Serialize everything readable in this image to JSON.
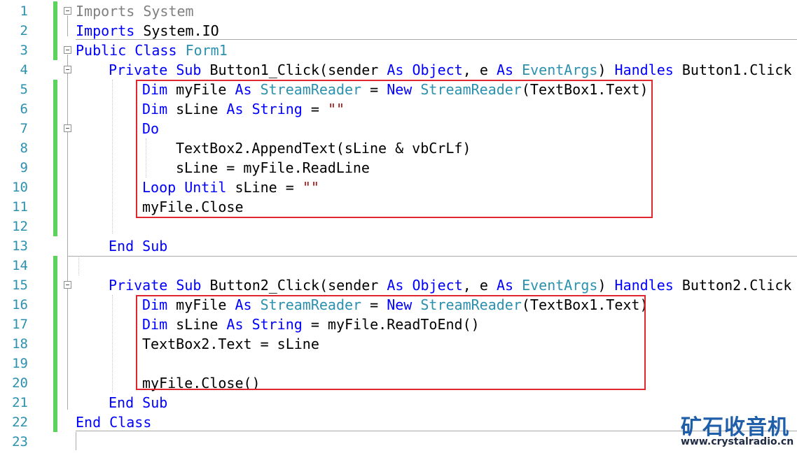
{
  "editor": {
    "line_numbers": [
      "1",
      "2",
      "3",
      "4",
      "5",
      "6",
      "7",
      "8",
      "9",
      "10",
      "11",
      "12",
      "13",
      "14",
      "15",
      "16",
      "17",
      "18",
      "19",
      "20",
      "21",
      "22",
      "23"
    ],
    "lines": [
      {
        "n": 1,
        "indent": 0,
        "tokens": [
          [
            "gr",
            "Imports"
          ],
          [
            "gr",
            " System"
          ]
        ]
      },
      {
        "n": 2,
        "indent": 0,
        "tokens": [
          [
            "kw",
            "Imports"
          ],
          [
            "pl",
            " System.IO"
          ]
        ]
      },
      {
        "n": 3,
        "indent": 0,
        "tokens": [
          [
            "kw",
            "Public"
          ],
          [
            "pl",
            " "
          ],
          [
            "kw",
            "Class"
          ],
          [
            "pl",
            " "
          ],
          [
            "ty",
            "Form1"
          ]
        ]
      },
      {
        "n": 4,
        "indent": 1,
        "tokens": [
          [
            "kw",
            "Private"
          ],
          [
            "pl",
            " "
          ],
          [
            "kw",
            "Sub"
          ],
          [
            "pl",
            " Button1_Click(sender "
          ],
          [
            "kw",
            "As"
          ],
          [
            "pl",
            " "
          ],
          [
            "kw",
            "Object"
          ],
          [
            "pl",
            ", e "
          ],
          [
            "kw",
            "As"
          ],
          [
            "pl",
            " "
          ],
          [
            "ty",
            "EventArgs"
          ],
          [
            "pl",
            ") "
          ],
          [
            "kw",
            "Handles"
          ],
          [
            "pl",
            " Button1.Click"
          ]
        ]
      },
      {
        "n": 5,
        "indent": 2,
        "tokens": [
          [
            "kw",
            "Dim"
          ],
          [
            "pl",
            " myFile "
          ],
          [
            "kw",
            "As"
          ],
          [
            "pl",
            " "
          ],
          [
            "ty",
            "StreamReader"
          ],
          [
            "pl",
            " = "
          ],
          [
            "kw",
            "New"
          ],
          [
            "pl",
            " "
          ],
          [
            "ty",
            "StreamReader"
          ],
          [
            "pl",
            "(TextBox1.Text)"
          ]
        ]
      },
      {
        "n": 6,
        "indent": 2,
        "tokens": [
          [
            "kw",
            "Dim"
          ],
          [
            "pl",
            " sLine "
          ],
          [
            "kw",
            "As"
          ],
          [
            "pl",
            " "
          ],
          [
            "kw",
            "String"
          ],
          [
            "pl",
            " = "
          ],
          [
            "st",
            "\"\""
          ]
        ]
      },
      {
        "n": 7,
        "indent": 2,
        "tokens": [
          [
            "kw",
            "Do"
          ]
        ]
      },
      {
        "n": 8,
        "indent": 3,
        "tokens": [
          [
            "pl",
            "TextBox2.AppendText(sLine & vbCrLf)"
          ]
        ]
      },
      {
        "n": 9,
        "indent": 3,
        "tokens": [
          [
            "pl",
            "sLine = myFile.ReadLine"
          ]
        ]
      },
      {
        "n": 10,
        "indent": 2,
        "tokens": [
          [
            "kw",
            "Loop"
          ],
          [
            "pl",
            " "
          ],
          [
            "kw",
            "Until"
          ],
          [
            "pl",
            " sLine = "
          ],
          [
            "st",
            "\"\""
          ]
        ]
      },
      {
        "n": 11,
        "indent": 2,
        "tokens": [
          [
            "pl",
            "myFile.Close"
          ]
        ]
      },
      {
        "n": 12,
        "indent": 2,
        "tokens": []
      },
      {
        "n": 13,
        "indent": 1,
        "tokens": [
          [
            "kw",
            "End"
          ],
          [
            "pl",
            " "
          ],
          [
            "kw",
            "Sub"
          ]
        ]
      },
      {
        "n": 14,
        "indent": 1,
        "tokens": []
      },
      {
        "n": 15,
        "indent": 1,
        "tokens": [
          [
            "kw",
            "Private"
          ],
          [
            "pl",
            " "
          ],
          [
            "kw",
            "Sub"
          ],
          [
            "pl",
            " Button2_Click(sender "
          ],
          [
            "kw",
            "As"
          ],
          [
            "pl",
            " "
          ],
          [
            "kw",
            "Object"
          ],
          [
            "pl",
            ", e "
          ],
          [
            "kw",
            "As"
          ],
          [
            "pl",
            " "
          ],
          [
            "ty",
            "EventArgs"
          ],
          [
            "pl",
            ") "
          ],
          [
            "kw",
            "Handles"
          ],
          [
            "pl",
            " Button2.Click"
          ]
        ]
      },
      {
        "n": 16,
        "indent": 2,
        "tokens": [
          [
            "kw",
            "Dim"
          ],
          [
            "pl",
            " myFile "
          ],
          [
            "kw",
            "As"
          ],
          [
            "pl",
            " "
          ],
          [
            "ty",
            "StreamReader"
          ],
          [
            "pl",
            " = "
          ],
          [
            "kw",
            "New"
          ],
          [
            "pl",
            " "
          ],
          [
            "ty",
            "StreamReader"
          ],
          [
            "pl",
            "(TextBox1.Text)"
          ]
        ]
      },
      {
        "n": 17,
        "indent": 2,
        "tokens": [
          [
            "kw",
            "Dim"
          ],
          [
            "pl",
            " sLine "
          ],
          [
            "kw",
            "As"
          ],
          [
            "pl",
            " "
          ],
          [
            "kw",
            "String"
          ],
          [
            "pl",
            " = myFile.ReadToEnd()"
          ]
        ]
      },
      {
        "n": 18,
        "indent": 2,
        "tokens": [
          [
            "pl",
            "TextBox2.Text = sLine"
          ]
        ]
      },
      {
        "n": 19,
        "indent": 2,
        "tokens": []
      },
      {
        "n": 20,
        "indent": 2,
        "tokens": [
          [
            "pl",
            "myFile.Close()"
          ]
        ]
      },
      {
        "n": 21,
        "indent": 1,
        "tokens": [
          [
            "kw",
            "End"
          ],
          [
            "pl",
            " "
          ],
          [
            "kw",
            "Sub"
          ]
        ]
      },
      {
        "n": 22,
        "indent": 0,
        "tokens": [
          [
            "kw",
            "End"
          ],
          [
            "pl",
            " "
          ],
          [
            "kw",
            "Class"
          ]
        ]
      },
      {
        "n": 23,
        "indent": 0,
        "tokens": []
      }
    ]
  },
  "colors": {
    "keyword": "#0000ff",
    "type": "#2b91af",
    "string": "#a31515",
    "comment_gray": "#808080",
    "line_number": "#2b91af",
    "change_bar": "#5cd35c",
    "highlight_box": "#e0262e"
  },
  "watermark": {
    "title": "矿石收音机",
    "url": "www.crystalradio.cn"
  }
}
